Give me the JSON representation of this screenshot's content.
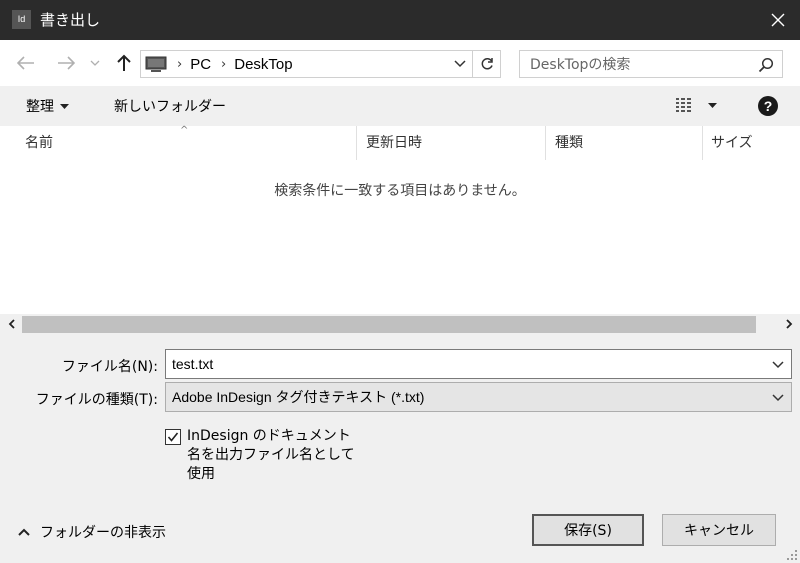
{
  "window": {
    "app_icon_text": "Id",
    "title": "書き出し"
  },
  "address": {
    "path": [
      "PC",
      "DeskTop"
    ],
    "search_placeholder": "DeskTopの検索"
  },
  "toolbar": {
    "organize_label": "整理",
    "new_folder_label": "新しいフォルダー"
  },
  "filelist": {
    "columns": [
      "名前",
      "更新日時",
      "種類",
      "サイズ"
    ],
    "empty_message": "検索条件に一致する項目はありません。"
  },
  "form": {
    "filename_label": "ファイル名(N):",
    "filename_value": "test.txt",
    "filetype_label": "ファイルの種類(T):",
    "filetype_value": "Adobe InDesign タグ付きテキスト (*.txt)",
    "checkbox_checked": true,
    "checkbox_label_lines": [
      "InDesign のドキュメント",
      "名を出力ファイル名として",
      "使用"
    ]
  },
  "footer": {
    "hide_folders_label": "フォルダーの非表示",
    "save_label": "保存(S)",
    "cancel_label": "キャンセル"
  }
}
